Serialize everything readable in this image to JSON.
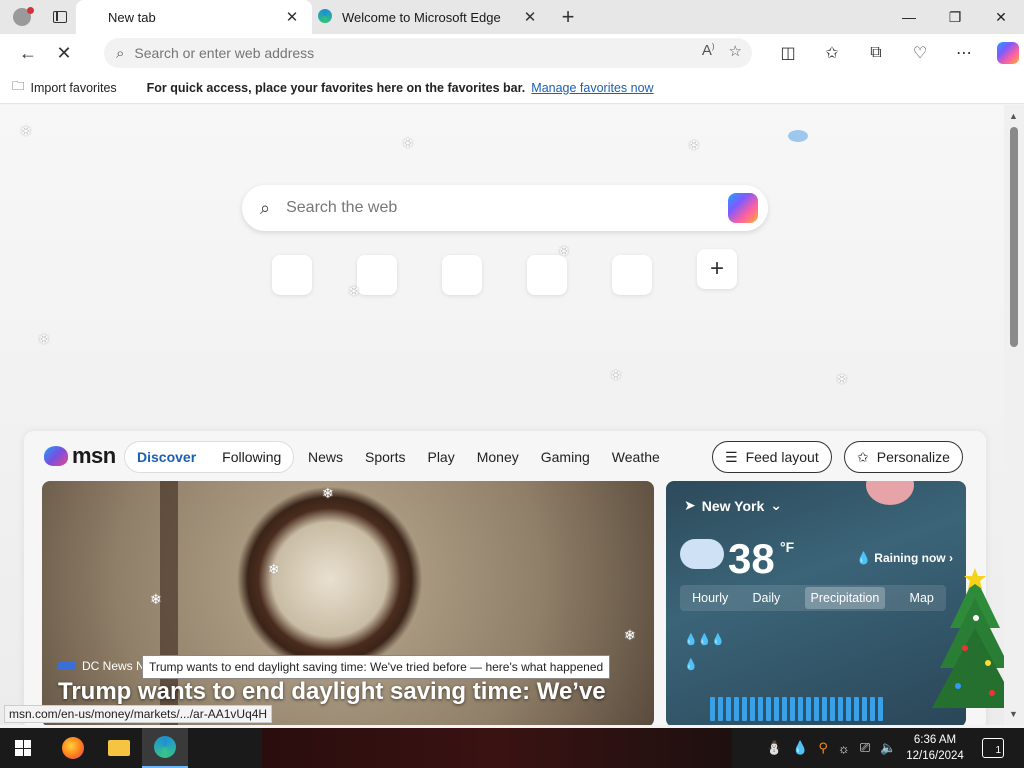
{
  "tabs": [
    {
      "title": "New tab",
      "active": true
    },
    {
      "title": "Welcome to Microsoft Edge",
      "active": false
    }
  ],
  "window_controls": {
    "minimize": "—",
    "maximize": "❐",
    "close": "✕"
  },
  "address_bar": {
    "placeholder": "Search or enter web address"
  },
  "favorites_bar": {
    "import_label": "Import favorites",
    "message": "For quick access, place your favorites here on the favorites bar.",
    "link": "Manage favorites now"
  },
  "ntp": {
    "search_placeholder": "Search the web",
    "add_site_symbol": "+"
  },
  "feed": {
    "logo": "msn",
    "tabs": [
      "Discover",
      "Following"
    ],
    "nav": [
      "News",
      "Sports",
      "Play",
      "Money",
      "Gaming",
      "Weathe"
    ],
    "feed_layout": "Feed layout",
    "personalize": "Personalize",
    "hero": {
      "source": "DC News N",
      "headline": "Trump wants to end daylight saving time: We've tried before — here's what happened",
      "headline_visible_line": "Trump wants to end daylight saving time: We’ve"
    },
    "weather": {
      "location": "New York",
      "temperature": "38",
      "unit": "°F",
      "condition": "Raining now",
      "tabs": [
        "Hourly",
        "Daily",
        "Precipitation",
        "Map"
      ],
      "selected_tab": "Precipitation"
    }
  },
  "tooltip": "Trump wants to end daylight saving time: We've tried before — here's what happened",
  "status_url": "msn.com/en-us/money/markets/.../ar-AA1vUq4H",
  "taskbar": {
    "time": "6:36 AM",
    "date": "12/16/2024",
    "notifications": "1"
  },
  "colors": {
    "accent": "#1a5fb4",
    "taskbar": "#1a1a1a",
    "titlebar": "#e7e7e7"
  }
}
